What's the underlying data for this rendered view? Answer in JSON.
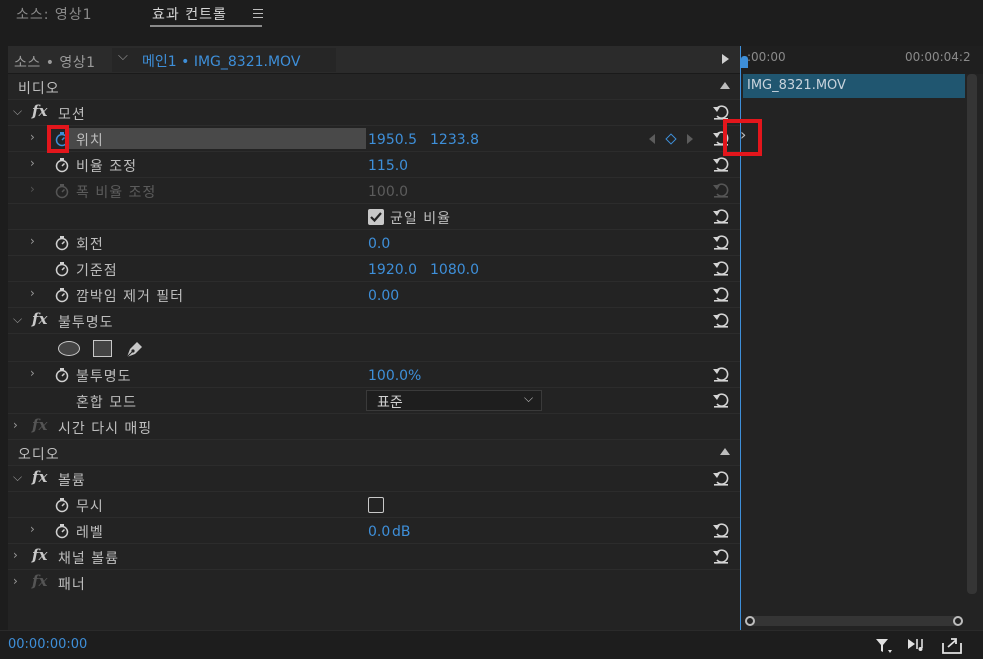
{
  "tabs": {
    "source": "소스: 영상1",
    "effect_controls": "효과 컨트롤",
    "menu_icon": "menu-icon"
  },
  "header": {
    "source_label": "소스 • 영상1",
    "sequence_label": "메인1 • IMG_8321.MOV"
  },
  "timeline": {
    "time_start": ":00:00",
    "time_end": "00:00:04:2",
    "clip_name": "IMG_8321.MOV"
  },
  "sections": {
    "video": "비디오",
    "audio": "오디오"
  },
  "motion": {
    "title": "모션",
    "position": {
      "label": "위치",
      "x": "1950.5",
      "y": "1233.8"
    },
    "scale": {
      "label": "비율 조정",
      "value": "115.0"
    },
    "scale_width": {
      "label": "폭 비율 조정",
      "value": "100.0"
    },
    "uniform_scale": {
      "label": "균일 비율",
      "checked": true
    },
    "rotation": {
      "label": "회전",
      "value": "0.0"
    },
    "anchor": {
      "label": "기준점",
      "x": "1920.0",
      "y": "1080.0"
    },
    "anti_flicker": {
      "label": "깜박임 제거 필터",
      "value": "0.00"
    }
  },
  "opacity": {
    "title": "불투명도",
    "opacity": {
      "label": "불투명도",
      "value": "100.0",
      "unit": "%"
    },
    "blend": {
      "label": "혼합 모드",
      "value": "표준"
    }
  },
  "time_remap": {
    "title": "시간 다시 매핑"
  },
  "volume": {
    "title": "볼륨",
    "bypass": {
      "label": "무시",
      "checked": false
    },
    "level": {
      "label": "레벨",
      "value": "0.0",
      "unit": "dB"
    }
  },
  "channel_volume": {
    "title": "채널 볼륨"
  },
  "panner": {
    "title": "패너"
  },
  "footer": {
    "timecode": "00:00:00:00"
  },
  "colors": {
    "accent": "#3e8fd9",
    "highlight": "#e3161c",
    "clip": "#205670"
  }
}
